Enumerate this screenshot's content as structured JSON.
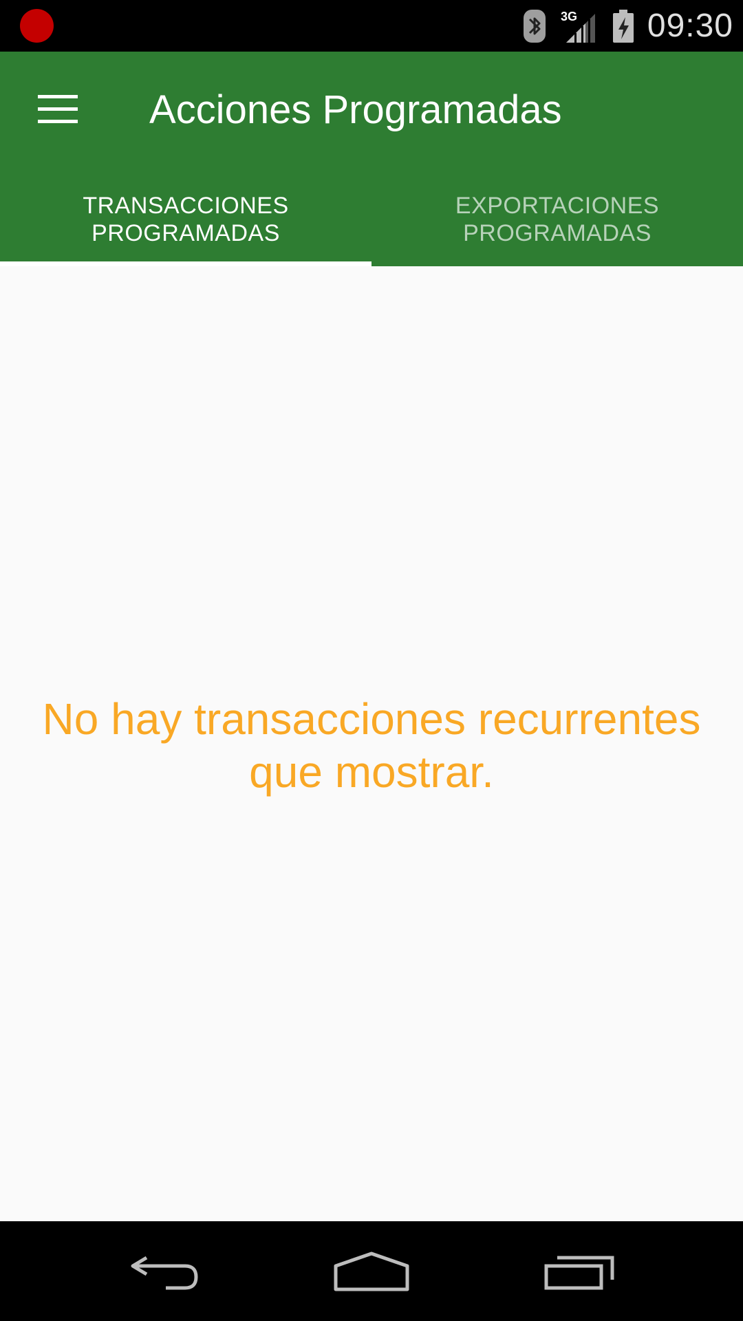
{
  "status_bar": {
    "time": "09:30",
    "network_type": "3G",
    "icons": [
      "record-indicator-icon",
      "bluetooth-icon",
      "signal-icon",
      "battery-charging-icon"
    ]
  },
  "toolbar": {
    "title": "Acciones Programadas",
    "menu_icon": "hamburger-menu-icon"
  },
  "tabs": [
    {
      "label": "TRANSACCIONES\nPROGRAMADAS",
      "selected": true
    },
    {
      "label": "EXPORTACIONES\nPROGRAMADAS",
      "selected": false
    }
  ],
  "content": {
    "empty_message": "No hay transacciones recurrentes que mostrar."
  },
  "nav_bar": {
    "icons": [
      "back-icon",
      "home-icon",
      "recents-icon"
    ]
  },
  "colors": {
    "app_bar": "#2e7d32",
    "empty_text": "#f9a825",
    "background": "#fafafa",
    "record_indicator": "#c40000"
  }
}
